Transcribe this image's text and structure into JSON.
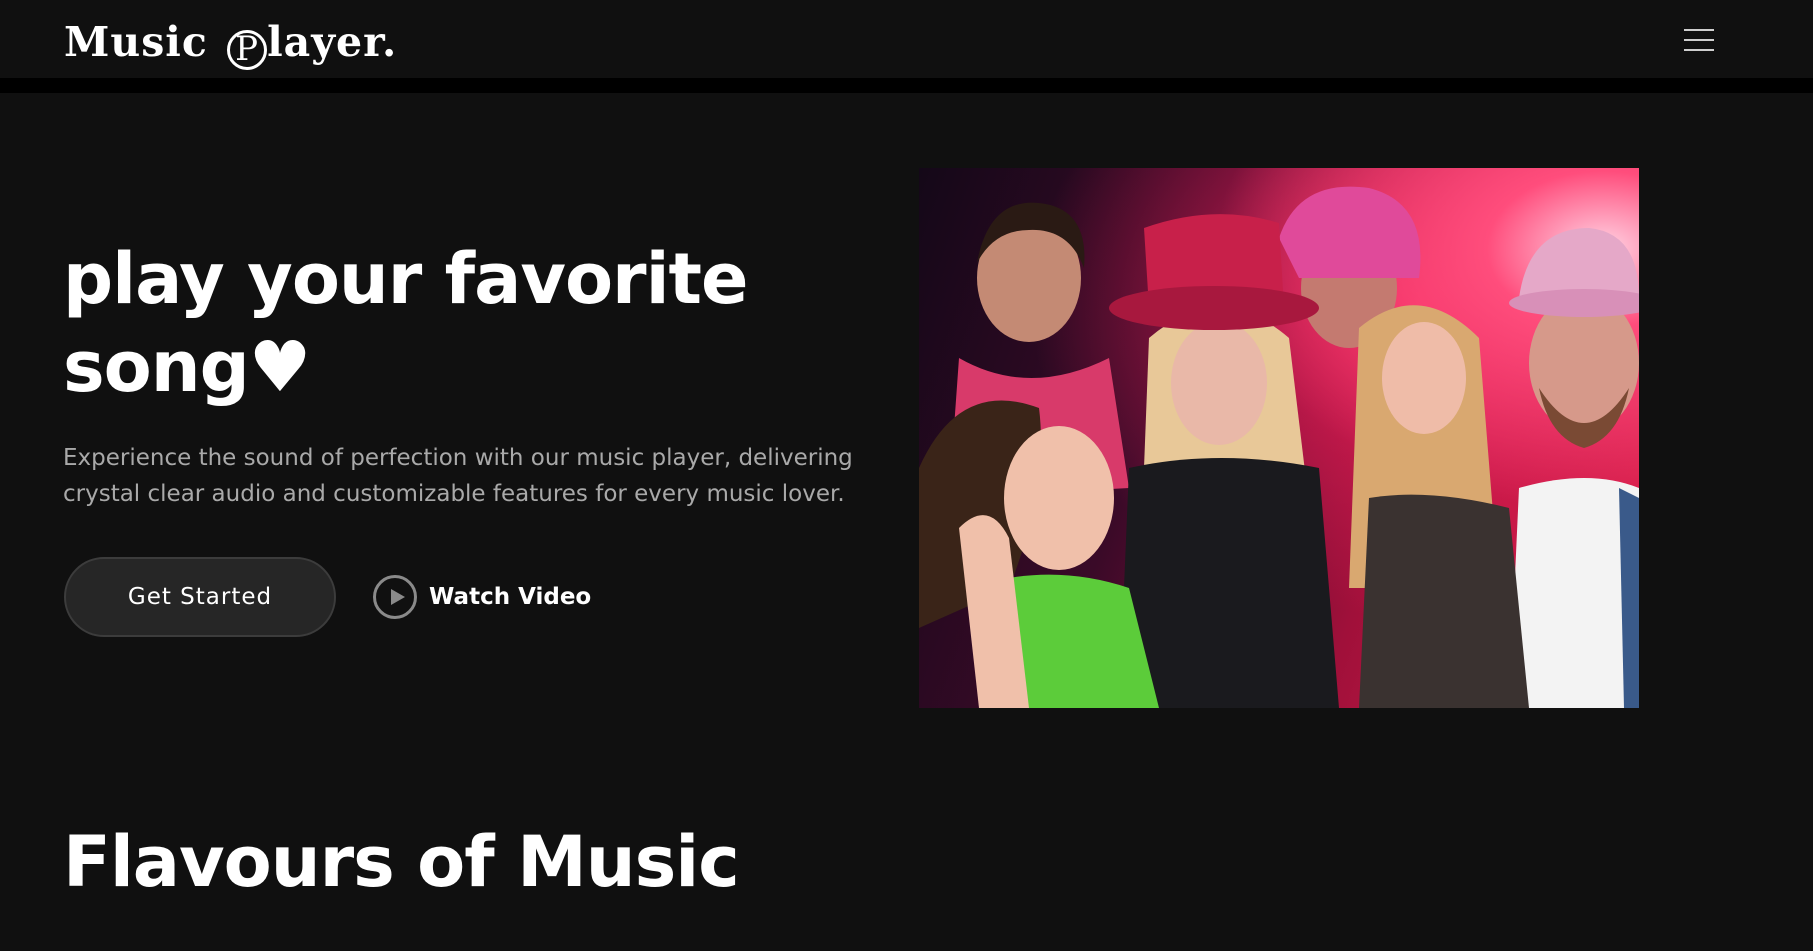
{
  "header": {
    "logo_before": "Music ",
    "logo_p": "P",
    "logo_after": "layer.",
    "menu_icon": "hamburger-menu-icon"
  },
  "hero": {
    "title": "play your favorite song♥",
    "description": "Experience the sound of perfection with our music player, delivering crystal clear audio and customizable features for every music lover.",
    "get_started_label": "Get Started",
    "watch_video_label": "Watch Video",
    "watch_video_icon": "play-circle-icon"
  },
  "section": {
    "title": "Flavours of Music"
  },
  "colors": {
    "background": "#101010",
    "header_strip": "#000000",
    "button_bg": "#262626",
    "muted_text": "#a9a9a9"
  }
}
